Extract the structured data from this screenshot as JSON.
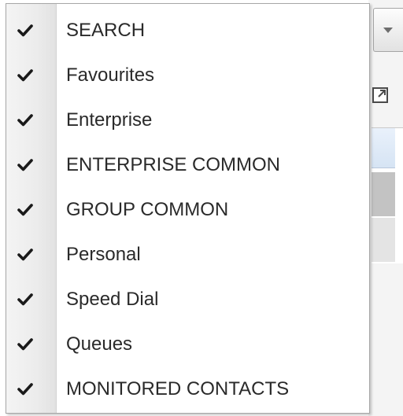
{
  "menu": {
    "items": [
      {
        "label": "SEARCH",
        "checked": true
      },
      {
        "label": "Favourites",
        "checked": true
      },
      {
        "label": "Enterprise",
        "checked": true
      },
      {
        "label": "ENTERPRISE COMMON",
        "checked": true
      },
      {
        "label": "GROUP COMMON",
        "checked": true
      },
      {
        "label": "Personal",
        "checked": true
      },
      {
        "label": "Speed Dial",
        "checked": true
      },
      {
        "label": "Queues",
        "checked": true
      },
      {
        "label": "MONITORED CONTACTS",
        "checked": true
      }
    ]
  },
  "icons": {
    "check": "checkmark-icon",
    "dropdown": "chevron-down-icon",
    "popout": "popout-icon"
  },
  "colors": {
    "menu_background": "#ffffff",
    "gutter": "#ececec",
    "text": "#2a2a2a",
    "check": "#1a1a1a",
    "selected_row": "#c3c3c3"
  }
}
